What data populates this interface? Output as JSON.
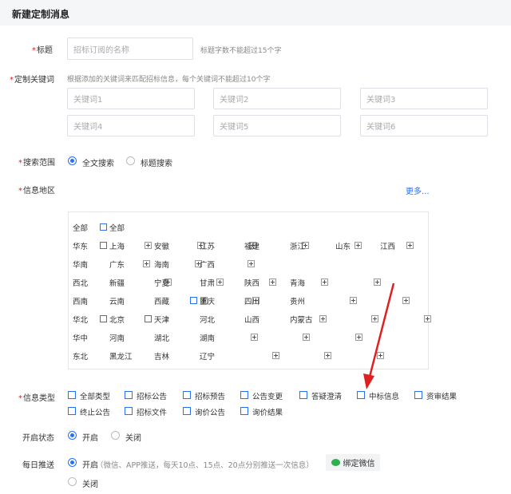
{
  "header": {
    "title": "新建定制消息"
  },
  "title_field": {
    "label": "标题",
    "placeholder": "招标订阅的名称",
    "hint": "标题字数不能超过15个字"
  },
  "keywords": {
    "label": "定制关键词",
    "hint": "根据添加的关键词来匹配招标信息，每个关键词不能超过10个字",
    "placeholders": [
      "关键词1",
      "关键词2",
      "关键词3",
      "关键词4",
      "关键词5",
      "关键词6"
    ]
  },
  "search_scope": {
    "label": "搜索范围",
    "options": [
      "全文搜索",
      "标题搜索"
    ],
    "selected": "全文搜索"
  },
  "region": {
    "label": "信息地区",
    "more": "更多...",
    "rows": [
      {
        "group": "全部",
        "items": [
          {
            "name": "全部",
            "type": "checkbox"
          }
        ]
      },
      {
        "group": "华东",
        "items": [
          {
            "name": "上海",
            "type": "checkbox"
          },
          {
            "name": "安徽",
            "type": "expand"
          },
          {
            "name": "江苏",
            "type": "expand"
          },
          {
            "name": "福建",
            "type": "expand"
          },
          {
            "name": "浙江",
            "type": "expand"
          },
          {
            "name": "山东",
            "type": "expand"
          },
          {
            "name": "江西",
            "type": "expand"
          }
        ]
      },
      {
        "group": "华南",
        "items": [
          {
            "name": "广东",
            "type": "expand"
          },
          {
            "name": "海南",
            "type": "expand"
          },
          {
            "name": "广西",
            "type": "expand"
          }
        ]
      },
      {
        "group": "西北",
        "items": [
          {
            "name": "新疆",
            "type": "expand"
          },
          {
            "name": "宁夏",
            "type": "expand"
          },
          {
            "name": "甘肃",
            "type": "expand"
          },
          {
            "name": "陕西",
            "type": "expand"
          },
          {
            "name": "青海",
            "type": "expand"
          }
        ]
      },
      {
        "group": "西南",
        "items": [
          {
            "name": "云南",
            "type": "expand"
          },
          {
            "name": "西藏",
            "type": "expand"
          },
          {
            "name": "重庆",
            "type": "checkbox"
          },
          {
            "name": "四川",
            "type": "expand"
          },
          {
            "name": "贵州",
            "type": "expand"
          }
        ]
      },
      {
        "group": "华北",
        "items": [
          {
            "name": "北京",
            "type": "checkbox"
          },
          {
            "name": "天津",
            "type": "checkbox"
          },
          {
            "name": "河北",
            "type": "expand"
          },
          {
            "name": "山西",
            "type": "expand"
          },
          {
            "name": "内蒙古",
            "type": "expand"
          }
        ]
      },
      {
        "group": "华中",
        "items": [
          {
            "name": "河南",
            "type": "expand"
          },
          {
            "name": "湖北",
            "type": "expand"
          },
          {
            "name": "湖南",
            "type": "expand"
          }
        ]
      },
      {
        "group": "东北",
        "items": [
          {
            "name": "黑龙江",
            "type": "expand"
          },
          {
            "name": "吉林",
            "type": "expand"
          },
          {
            "name": "辽宁",
            "type": "expand"
          }
        ]
      }
    ]
  },
  "info_type": {
    "label": "信息类型",
    "row1": [
      "全部类型",
      "招标公告",
      "招标预告",
      "公告变更",
      "答疑澄清",
      "中标信息",
      "资审结果"
    ],
    "row2": [
      "终止公告",
      "招标文件",
      "询价公告",
      "询价结果"
    ]
  },
  "status": {
    "label": "开启状态",
    "options": [
      "开启",
      "关闭"
    ],
    "selected": "开启"
  },
  "daily_push": {
    "label": "每日推送",
    "options": [
      "开启",
      "关闭"
    ],
    "selected": "开启",
    "note": "（微信、APP推送，每天10点、15点、20点分别推送一次信息）",
    "bind_wechat": "绑定微信"
  },
  "colors": {
    "accent": "#2b6ff2",
    "required": "#e02020",
    "arrow": "#e02020",
    "wechat": "#2bb24c"
  }
}
